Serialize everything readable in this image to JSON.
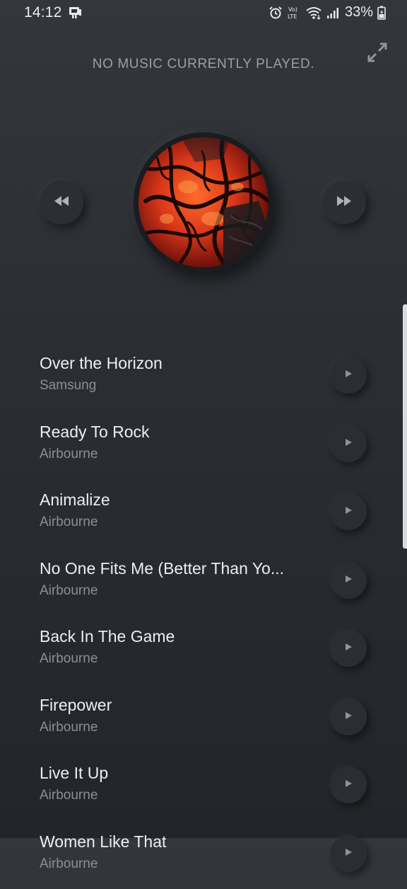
{
  "status_bar": {
    "time": "14:12",
    "battery": "33%",
    "network": "LTE",
    "icons": [
      "notification-icon",
      "alarm-icon",
      "volte-icon",
      "wifi-icon",
      "signal-icon",
      "battery-icon"
    ]
  },
  "header": {
    "now_playing_text": "NO MUSIC CURRENTLY PLAYED.",
    "expand_icon": "expand-icon"
  },
  "player": {
    "rewind_icon": "rewind-icon",
    "forward_icon": "fast-forward-icon",
    "album_art": "album-art"
  },
  "tracks": [
    {
      "title": "Over the Horizon",
      "artist": "Samsung"
    },
    {
      "title": "Ready To Rock",
      "artist": "Airbourne"
    },
    {
      "title": "Animalize",
      "artist": "Airbourne"
    },
    {
      "title": "No One Fits Me (Better Than Yo...",
      "artist": "Airbourne"
    },
    {
      "title": "Back In The Game",
      "artist": "Airbourne"
    },
    {
      "title": "Firepower",
      "artist": "Airbourne"
    },
    {
      "title": "Live It Up",
      "artist": "Airbourne"
    },
    {
      "title": "Women Like That",
      "artist": "Airbourne"
    }
  ],
  "colors": {
    "background": "#2b2e33",
    "text_primary": "#eceef2",
    "text_secondary": "#8a9098"
  }
}
